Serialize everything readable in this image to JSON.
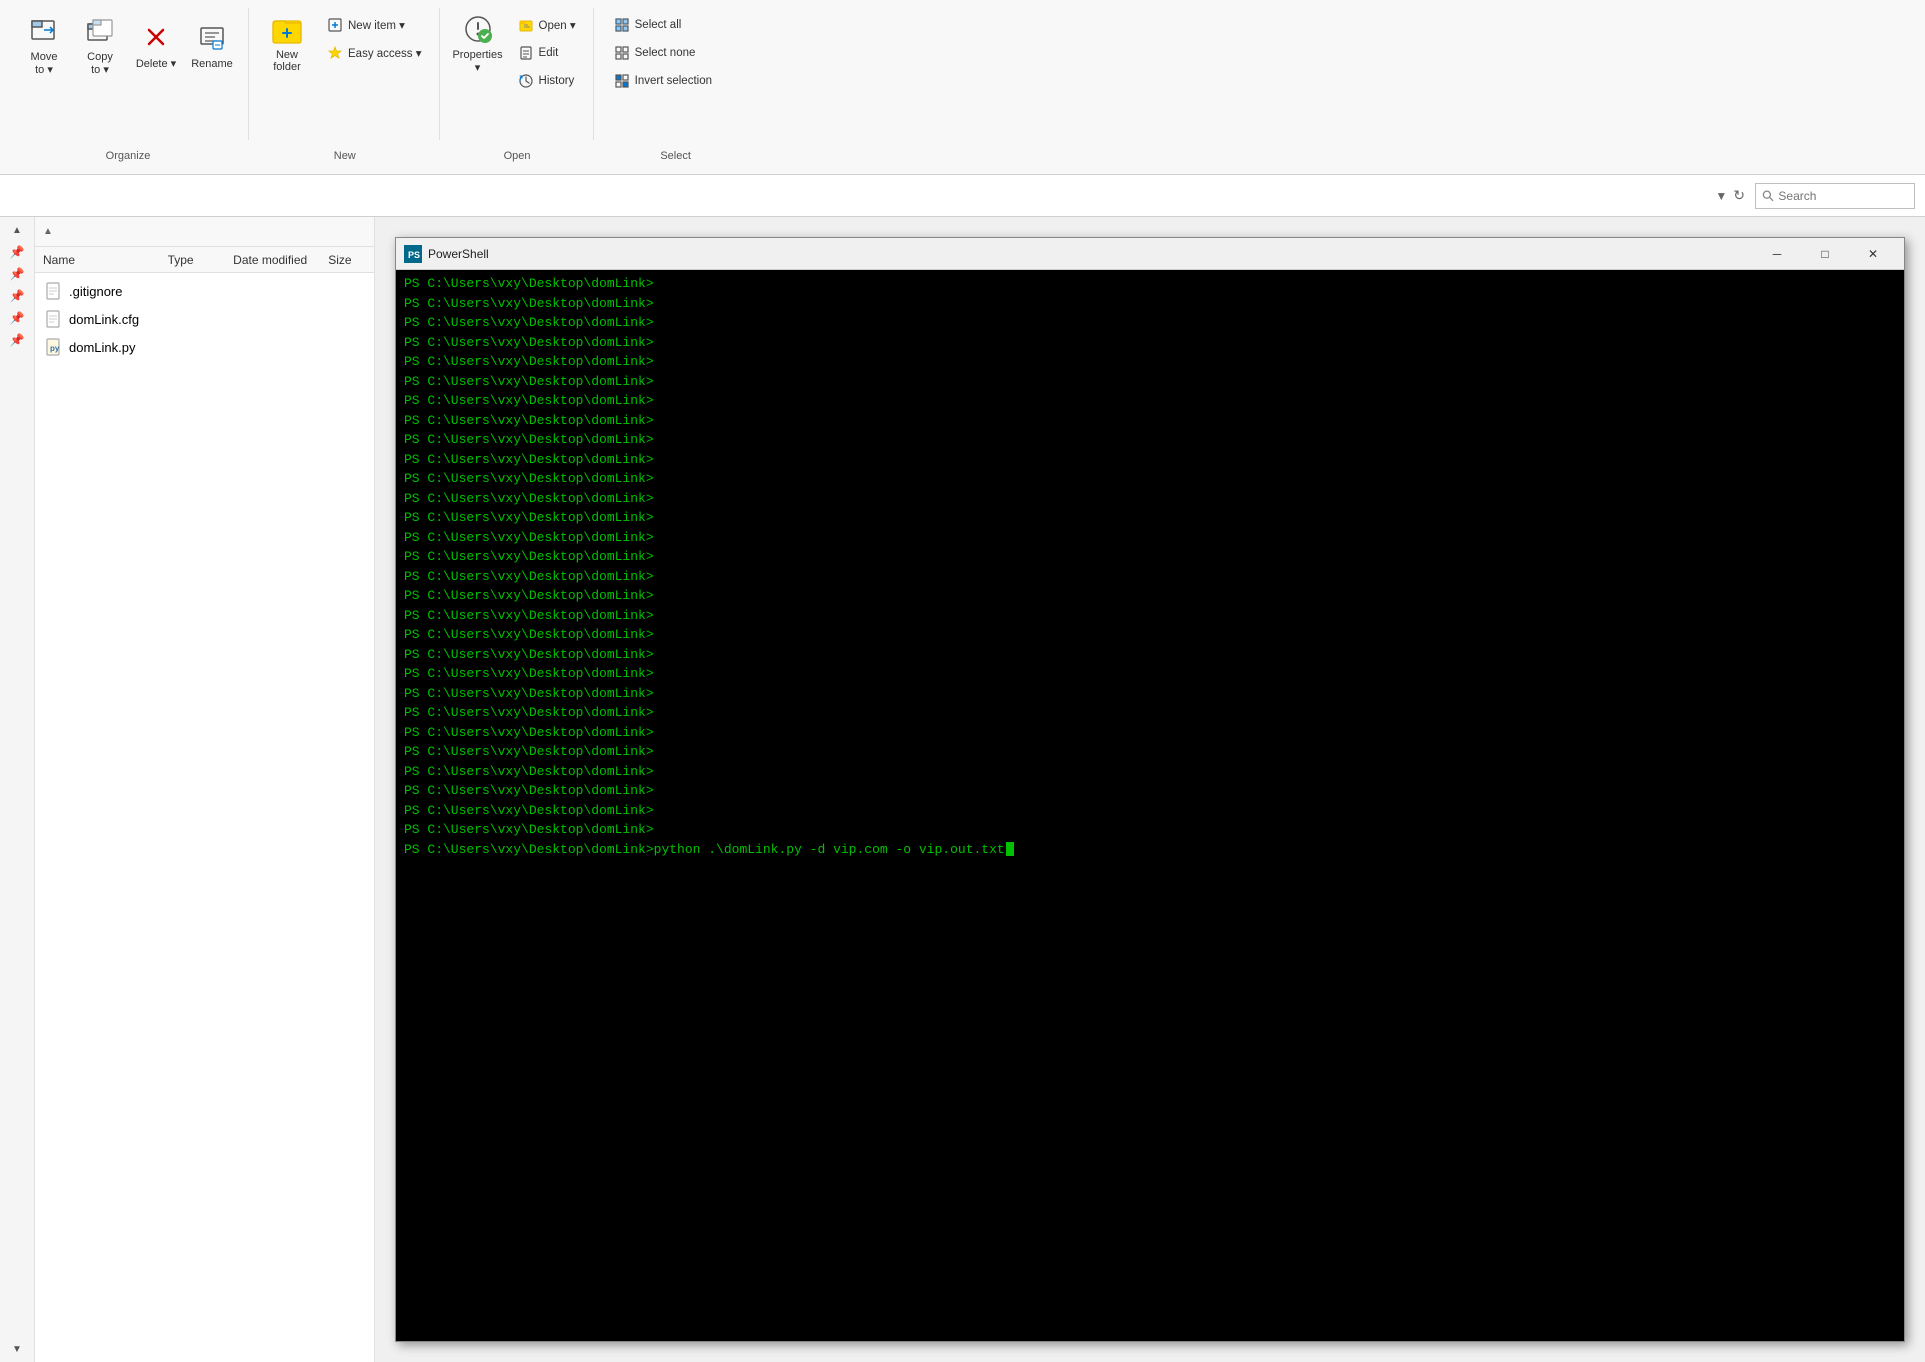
{
  "ribbon": {
    "groups": [
      {
        "id": "organize",
        "label": "Organize",
        "buttons": [
          {
            "id": "move-to",
            "label": "Move\nto",
            "icon": "move-icon",
            "hasDropdown": true
          },
          {
            "id": "copy-to",
            "label": "Copy\nto",
            "icon": "copy-icon",
            "hasDropdown": true
          },
          {
            "id": "delete",
            "label": "Delete",
            "icon": "delete-icon",
            "hasDropdown": true
          },
          {
            "id": "rename",
            "label": "Rename",
            "icon": "rename-icon"
          }
        ]
      },
      {
        "id": "new",
        "label": "New",
        "buttons": [
          {
            "id": "new-folder",
            "label": "New\nfolder",
            "icon": "folder-icon"
          },
          {
            "id": "new-item",
            "label": "New item",
            "icon": "new-item-icon",
            "hasDropdown": true,
            "small": true
          },
          {
            "id": "easy-access",
            "label": "Easy access",
            "icon": "easy-access-icon",
            "hasDropdown": true,
            "small": true
          }
        ]
      },
      {
        "id": "open",
        "label": "Open",
        "buttons": [
          {
            "id": "properties",
            "label": "Properties",
            "icon": "properties-icon",
            "large": true,
            "hasDropdown": true
          },
          {
            "id": "open-btn",
            "label": "Open",
            "icon": "open-icon",
            "hasDropdown": true,
            "small": true
          },
          {
            "id": "edit",
            "label": "Edit",
            "icon": "edit-icon",
            "small": true
          },
          {
            "id": "history",
            "label": "History",
            "icon": "history-icon",
            "small": true
          }
        ]
      },
      {
        "id": "select",
        "label": "Select",
        "buttons": [
          {
            "id": "select-all",
            "label": "Select all",
            "icon": "select-all-icon",
            "small": true
          },
          {
            "id": "select-none",
            "label": "Select none",
            "icon": "select-none-icon",
            "small": true
          },
          {
            "id": "invert-selection",
            "label": "Invert selection",
            "icon": "invert-icon",
            "small": true
          }
        ]
      }
    ]
  },
  "search": {
    "placeholder": "Search",
    "label": "Search"
  },
  "columns": [
    {
      "id": "name",
      "label": "Name"
    },
    {
      "id": "type",
      "label": "Type"
    },
    {
      "id": "date-modified",
      "label": "Date modified"
    },
    {
      "id": "size",
      "label": "Size"
    }
  ],
  "files": [
    {
      "id": "gitignore",
      "name": ".gitignore",
      "icon": "text-file-icon",
      "type": "text"
    },
    {
      "id": "domlink-cfg",
      "name": "domLink.cfg",
      "icon": "config-file-icon",
      "type": "cfg"
    },
    {
      "id": "domlink-py",
      "name": "domLink.py",
      "icon": "python-file-icon",
      "type": "python"
    }
  ],
  "powershell": {
    "title": "PowerShell",
    "prompt": "PS C:\\Users\\vxy\\Desktop\\domLink> ",
    "lines": [
      "PS C:\\Users\\vxy\\Desktop\\domLink>",
      "PS C:\\Users\\vxy\\Desktop\\domLink>",
      "PS C:\\Users\\vxy\\Desktop\\domLink>",
      "PS C:\\Users\\vxy\\Desktop\\domLink>",
      "PS C:\\Users\\vxy\\Desktop\\domLink>",
      "PS C:\\Users\\vxy\\Desktop\\domLink>",
      "PS C:\\Users\\vxy\\Desktop\\domLink>",
      "PS C:\\Users\\vxy\\Desktop\\domLink>",
      "PS C:\\Users\\vxy\\Desktop\\domLink>",
      "PS C:\\Users\\vxy\\Desktop\\domLink>",
      "PS C:\\Users\\vxy\\Desktop\\domLink>",
      "PS C:\\Users\\vxy\\Desktop\\domLink>",
      "PS C:\\Users\\vxy\\Desktop\\domLink>",
      "PS C:\\Users\\vxy\\Desktop\\domLink>",
      "PS C:\\Users\\vxy\\Desktop\\domLink>",
      "PS C:\\Users\\vxy\\Desktop\\domLink>",
      "PS C:\\Users\\vxy\\Desktop\\domLink>",
      "PS C:\\Users\\vxy\\Desktop\\domLink>",
      "PS C:\\Users\\vxy\\Desktop\\domLink>",
      "PS C:\\Users\\vxy\\Desktop\\domLink>",
      "PS C:\\Users\\vxy\\Desktop\\domLink>",
      "PS C:\\Users\\vxy\\Desktop\\domLink>",
      "PS C:\\Users\\vxy\\Desktop\\domLink>",
      "PS C:\\Users\\vxy\\Desktop\\domLink>",
      "PS C:\\Users\\vxy\\Desktop\\domLink>",
      "PS C:\\Users\\vxy\\Desktop\\domLink>",
      "PS C:\\Users\\vxy\\Desktop\\domLink>",
      "PS C:\\Users\\vxy\\Desktop\\domLink>",
      "PS C:\\Users\\vxy\\Desktop\\domLink>"
    ],
    "last_line_prompt": "PS C:\\Users\\vxy\\Desktop\\domLink> ",
    "last_line_command": "python .\\domLink.py -d vip.com -o vip.out.txt"
  }
}
